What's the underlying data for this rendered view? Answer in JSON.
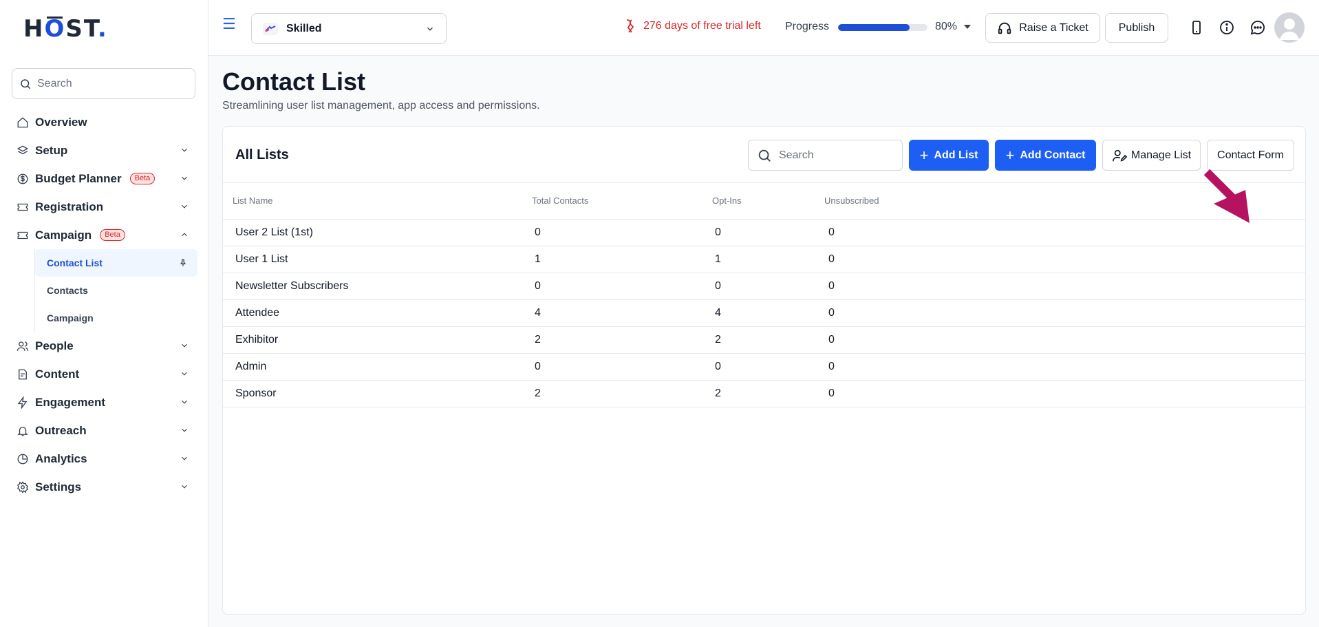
{
  "brand": {
    "logo_h": "H",
    "logo_o": "O",
    "logo_rest": "ST",
    "logo_dot": "."
  },
  "sidebar": {
    "search_placeholder": "Search",
    "items": [
      {
        "label": "Overview",
        "icon": "home-icon"
      },
      {
        "label": "Setup",
        "icon": "layers-icon"
      },
      {
        "label": "Budget Planner",
        "icon": "dollar-icon",
        "badge": "Beta"
      },
      {
        "label": "Registration",
        "icon": "ticket-icon"
      },
      {
        "label": "Campaign",
        "icon": "ticket-icon",
        "badge": "Beta"
      },
      {
        "label": "People",
        "icon": "users-icon"
      },
      {
        "label": "Content",
        "icon": "document-icon"
      },
      {
        "label": "Engagement",
        "icon": "lightning-icon"
      },
      {
        "label": "Outreach",
        "icon": "bell-icon"
      },
      {
        "label": "Analytics",
        "icon": "pie-chart-icon"
      },
      {
        "label": "Settings",
        "icon": "gear-icon"
      }
    ],
    "campaign_sub": [
      "Contact List",
      "Contacts",
      "Campaign"
    ]
  },
  "topbar": {
    "event_name": "Skilled",
    "trial_text": "276 days of free trial left",
    "progress_label": "Progress",
    "progress_value": "80%",
    "progress_fraction": 0.8,
    "raise_ticket": "Raise a Ticket",
    "publish": "Publish"
  },
  "page": {
    "title": "Contact List",
    "subtitle": "Streamlining user list management, app access and permissions."
  },
  "card": {
    "title": "All Lists",
    "search_placeholder": "Search",
    "add_list": "Add List",
    "add_contact": "Add Contact",
    "manage_list": "Manage List",
    "contact_form": "Contact Form",
    "columns": [
      "List Name",
      "Total Contacts",
      "Opt-Ins",
      "Unsubscribed"
    ],
    "rows": [
      {
        "name": "User 2 List (1st)",
        "total": "0",
        "optins": "0",
        "unsub": "0",
        "deletable": true
      },
      {
        "name": "User 1 List",
        "total": "1",
        "optins": "1",
        "unsub": "0",
        "deletable": true
      },
      {
        "name": "Newsletter Subscribers",
        "total": "0",
        "optins": "0",
        "unsub": "0",
        "deletable": true
      },
      {
        "name": "Attendee",
        "total": "4",
        "optins": "4",
        "unsub": "0",
        "deletable": false
      },
      {
        "name": "Exhibitor",
        "total": "2",
        "optins": "2",
        "unsub": "0",
        "deletable": true
      },
      {
        "name": "Admin",
        "total": "0",
        "optins": "0",
        "unsub": "0",
        "deletable": true
      },
      {
        "name": "Sponsor",
        "total": "2",
        "optins": "2",
        "unsub": "0",
        "deletable": true
      }
    ]
  },
  "colors": {
    "accent": "#1d5ff5",
    "danger": "#dc2626",
    "annotation_arrow": "#b5135f"
  }
}
